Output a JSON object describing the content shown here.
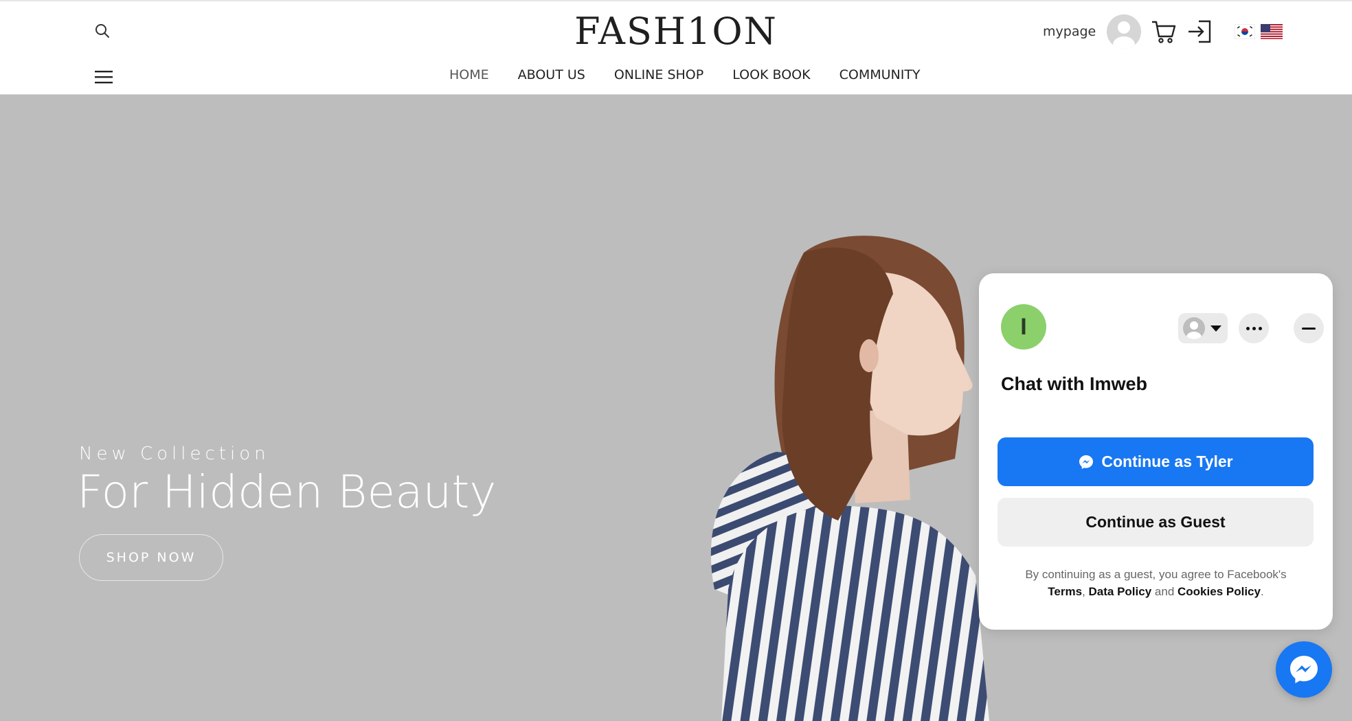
{
  "header": {
    "logo": "FASH1ON",
    "nav": [
      {
        "label": "HOME"
      },
      {
        "label": "ABOUT US"
      },
      {
        "label": "ONLINE SHOP"
      },
      {
        "label": "LOOK BOOK"
      },
      {
        "label": "COMMUNITY"
      }
    ],
    "mypage_label": "mypage",
    "icons": [
      "search-icon",
      "menu-icon",
      "avatar-icon",
      "cart-icon",
      "login-icon",
      "flag-korea-icon",
      "flag-usa-icon"
    ]
  },
  "hero": {
    "subtitle": "New Collection",
    "title": "For Hidden Beauty",
    "button_label": "SHOP NOW",
    "background_color": "#bdbdbd"
  },
  "chat": {
    "logo_letter": "I",
    "title": "Chat with Imweb",
    "primary_button": "Continue as Tyler",
    "secondary_button": "Continue as Guest",
    "legal_text": "By continuing as a guest, you agree to Facebook's",
    "legal_terms": "Terms",
    "legal_data": "Data Policy",
    "legal_and": "and",
    "legal_cookies": "Cookies Policy",
    "accent_color": "#1877f2",
    "logo_color": "#8bd06a"
  }
}
